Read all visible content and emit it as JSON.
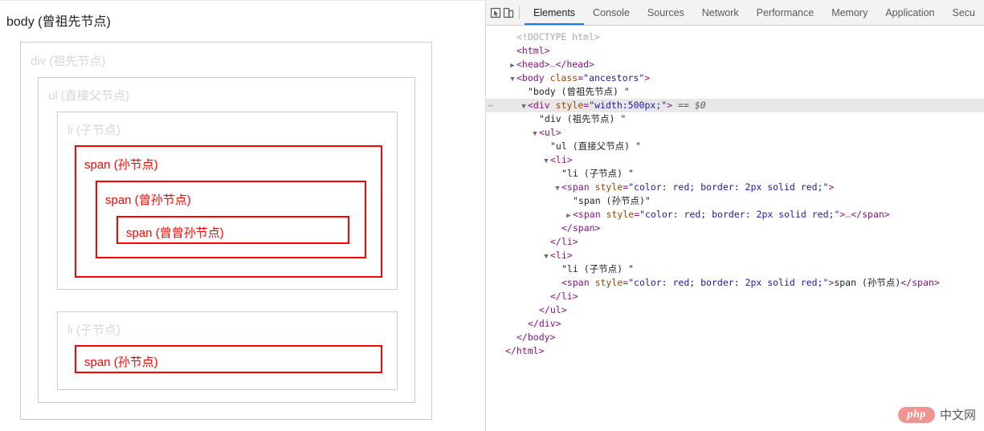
{
  "page": {
    "body_label": "body (曾祖先节点)",
    "boxes": {
      "div": "div (祖先节点)",
      "ul": "ul (直接父节点)",
      "li1": "li (子节点)",
      "li2": "li (子节点)",
      "span_sun1": "span (孙节点)",
      "span_zengsun": "span (曾孙节点)",
      "span_zengzengsun": "span (曾曾孙节点)",
      "span_sun2": "span (孙节点)"
    },
    "colors": {
      "outline": "#cccccc",
      "outline_text": "#d6d6d6",
      "highlight": "#ff0000",
      "body_text": "#222222"
    }
  },
  "devtools": {
    "icons": [
      {
        "name": "inspect-element-icon"
      },
      {
        "name": "device-toolbar-icon"
      }
    ],
    "tabs": [
      {
        "label": "Elements",
        "active": true
      },
      {
        "label": "Console",
        "active": false
      },
      {
        "label": "Sources",
        "active": false
      },
      {
        "label": "Network",
        "active": false
      },
      {
        "label": "Performance",
        "active": false
      },
      {
        "label": "Memory",
        "active": false
      },
      {
        "label": "Application",
        "active": false
      },
      {
        "label": "Secu",
        "active": false
      }
    ],
    "active_tab_color": "#1a73e8",
    "tree": [
      {
        "indent": 0,
        "twisty": "none",
        "selected": false,
        "kind": "doctype",
        "text": "<!DOCTYPE html>"
      },
      {
        "indent": 0,
        "twisty": "none",
        "selected": false,
        "kind": "tag_open_simple",
        "tag": "html"
      },
      {
        "indent": 0,
        "twisty": "collapsed",
        "selected": false,
        "kind": "collapsed_pair",
        "tag": "head"
      },
      {
        "indent": 0,
        "twisty": "expanded",
        "selected": false,
        "kind": "tag_open_attr",
        "tag": "body",
        "attr": "class",
        "value": "\"ancestors\""
      },
      {
        "indent": 1,
        "twisty": "none",
        "selected": false,
        "kind": "text",
        "text": "\"body (曾祖先节点) \""
      },
      {
        "indent": 1,
        "twisty": "expanded",
        "selected": true,
        "kind": "tag_open_attr_sel",
        "tag": "div",
        "attr": "style",
        "value": "\"width:500px;\"",
        "selector": "== $0"
      },
      {
        "indent": 2,
        "twisty": "none",
        "selected": false,
        "kind": "text",
        "text": "\"div (祖先节点) \""
      },
      {
        "indent": 2,
        "twisty": "expanded",
        "selected": false,
        "kind": "tag_open_simple",
        "tag": "ul"
      },
      {
        "indent": 3,
        "twisty": "none",
        "selected": false,
        "kind": "text",
        "text": "\"ul (直接父节点) \""
      },
      {
        "indent": 3,
        "twisty": "expanded",
        "selected": false,
        "kind": "tag_open_simple",
        "tag": "li"
      },
      {
        "indent": 4,
        "twisty": "none",
        "selected": false,
        "kind": "text",
        "text": "\"li (子节点) \""
      },
      {
        "indent": 4,
        "twisty": "expanded",
        "selected": false,
        "kind": "tag_open_attr",
        "tag": "span",
        "attr": "style",
        "value": "\"color: red; border: 2px solid red;\""
      },
      {
        "indent": 5,
        "twisty": "none",
        "selected": false,
        "kind": "text",
        "text": "\"span (孙节点)\""
      },
      {
        "indent": 5,
        "twisty": "collapsed",
        "selected": false,
        "kind": "collapsed_attr",
        "tag": "span",
        "attr": "style",
        "value": "\"color: red; border: 2px solid red;\"",
        "ellipsis": "…"
      },
      {
        "indent": 4,
        "twisty": "none",
        "selected": false,
        "kind": "tag_close",
        "tag": "span"
      },
      {
        "indent": 3,
        "twisty": "none",
        "selected": false,
        "kind": "tag_close",
        "tag": "li"
      },
      {
        "indent": 3,
        "twisty": "expanded",
        "selected": false,
        "kind": "tag_open_simple",
        "tag": "li"
      },
      {
        "indent": 4,
        "twisty": "none",
        "selected": false,
        "kind": "text",
        "text": "\"li (子节点) \""
      },
      {
        "indent": 4,
        "twisty": "none",
        "selected": false,
        "kind": "inline_element",
        "tag": "span",
        "attr": "style",
        "value": "\"color: red; border: 2px solid red;\"",
        "inner": "span (孙节点)"
      },
      {
        "indent": 3,
        "twisty": "none",
        "selected": false,
        "kind": "tag_close",
        "tag": "li"
      },
      {
        "indent": 2,
        "twisty": "none",
        "selected": false,
        "kind": "tag_close",
        "tag": "ul"
      },
      {
        "indent": 1,
        "twisty": "none",
        "selected": false,
        "kind": "tag_close",
        "tag": "div"
      },
      {
        "indent": 0,
        "twisty": "none",
        "selected": false,
        "kind": "tag_close",
        "tag": "body"
      },
      {
        "indent": -1,
        "twisty": "none",
        "selected": false,
        "kind": "tag_close",
        "tag": "html"
      }
    ]
  },
  "watermark": {
    "badge": "php",
    "text": "中文网"
  }
}
